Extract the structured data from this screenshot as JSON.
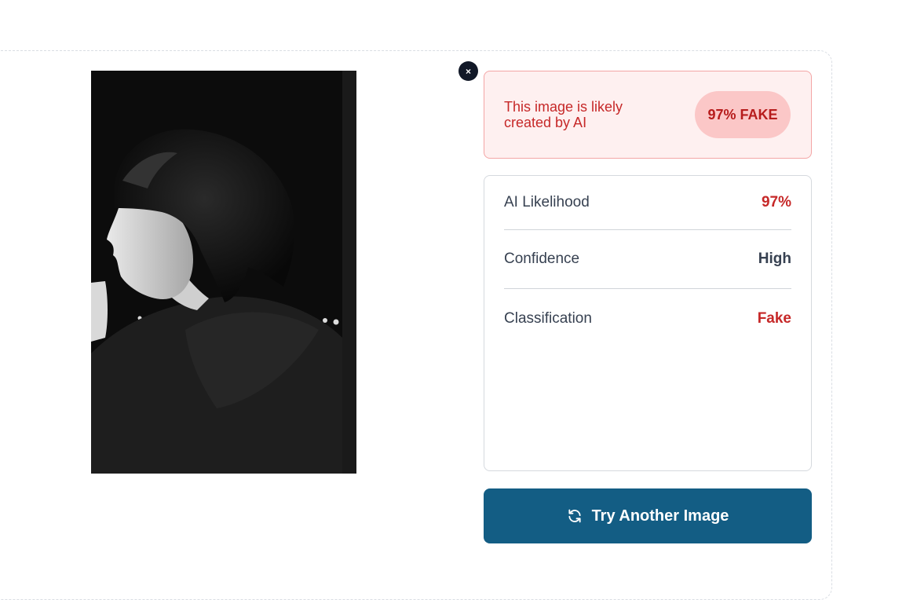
{
  "close_button": {
    "label": "×"
  },
  "result": {
    "summary": "This image is likely created by AI",
    "badge": "97% FAKE",
    "colors": {
      "fake_red": "#c62828",
      "badge_bg": "#fbc7c7",
      "panel_bg": "#fef0f0"
    }
  },
  "metrics": [
    {
      "label": "AI Likelihood",
      "value": "97%",
      "tone": "red"
    },
    {
      "label": "Confidence",
      "value": "High",
      "tone": "dark"
    },
    {
      "label": "Classification",
      "value": "Fake",
      "tone": "red"
    }
  ],
  "action": {
    "label": "Try Another Image",
    "icon": "refresh-icon",
    "color": "#135d84"
  },
  "image": {
    "icon": "uploaded-photo"
  }
}
